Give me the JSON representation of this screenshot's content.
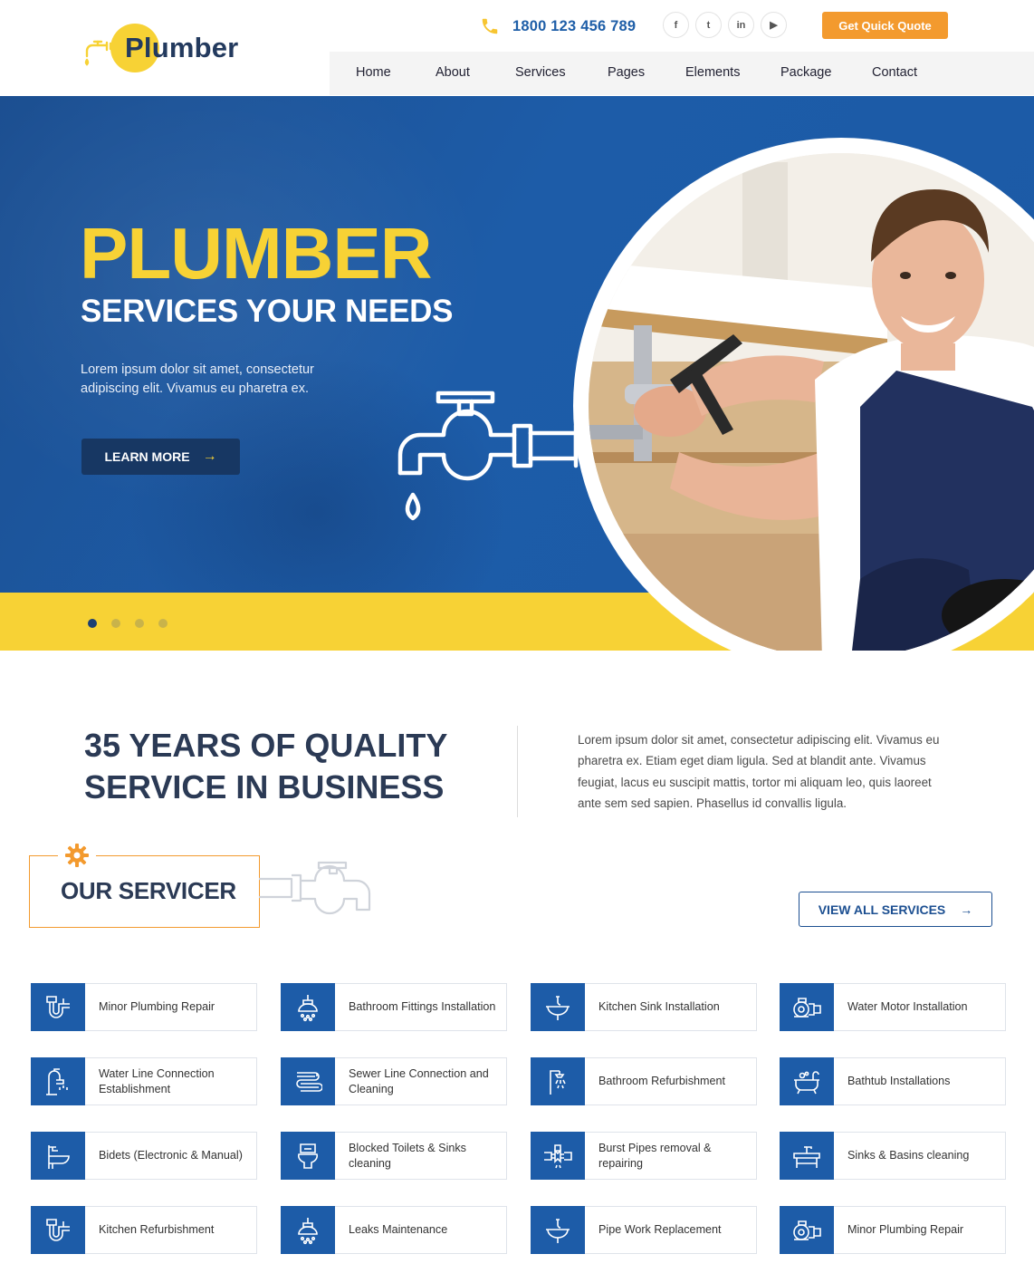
{
  "brand": {
    "name": "Plumber"
  },
  "topbar": {
    "phone": "1800 123 456 789",
    "socials": [
      {
        "icon": "facebook-icon",
        "glyph": "f"
      },
      {
        "icon": "twitter-icon",
        "glyph": "t"
      },
      {
        "icon": "linkedin-icon",
        "glyph": "in"
      },
      {
        "icon": "youtube-icon",
        "glyph": "▶"
      }
    ],
    "quote_label": "Get Quick Quote"
  },
  "nav": {
    "items": [
      "Home",
      "About",
      "Services",
      "Pages",
      "Elements",
      "Package",
      "Contact"
    ]
  },
  "hero": {
    "title": "PLUMBER",
    "subtitle": "SERVICES YOUR NEEDS",
    "description": "Lorem ipsum dolor sit amet, consectetur adipiscing elit. Vivamus eu pharetra ex.",
    "button": "LEARN MORE",
    "slides": 4,
    "active_slide": 1
  },
  "about": {
    "title": "35 YEARS OF QUALITY SERVICE IN BUSINESS",
    "description": "Lorem ipsum dolor sit amet, consectetur adipiscing elit. Vivamus eu pharetra ex. Etiam eget diam ligula. Sed at blandit ante. Vivamus feugiat, lacus eu suscipit mattis, tortor mi aliquam leo, quis laoreet ante sem sed sapien. Phasellus id convallis ligula."
  },
  "services": {
    "heading": "OUR SERVICER",
    "view_all": "VIEW ALL SERVICES",
    "items": [
      {
        "label": "Minor Plumbing Repair",
        "icon": "pipe-trap-icon"
      },
      {
        "label": "Bathroom Fittings Installation",
        "icon": "shower-head-icon"
      },
      {
        "label": "Kitchen Sink Installation",
        "icon": "sink-icon"
      },
      {
        "label": "Water Motor Installation",
        "icon": "water-motor-icon"
      },
      {
        "label": "Water Line Connection Establishment",
        "icon": "faucet-icon"
      },
      {
        "label": "Sewer Line Connection and Cleaning",
        "icon": "sewer-pipe-icon"
      },
      {
        "label": "Bathroom Refurbishment",
        "icon": "shower-icon"
      },
      {
        "label": "Bathtub Installations",
        "icon": "bathtub-icon"
      },
      {
        "label": "Bidets (Electronic & Manual)",
        "icon": "bidet-icon"
      },
      {
        "label": "Blocked Toilets & Sinks cleaning",
        "icon": "toilet-icon"
      },
      {
        "label": "Burst Pipes removal & repairing",
        "icon": "burst-pipe-icon"
      },
      {
        "label": "Sinks & Basins cleaning",
        "icon": "basin-icon"
      },
      {
        "label": "Kitchen Refurbishment",
        "icon": "pipe-trap-icon"
      },
      {
        "label": "Leaks Maintenance",
        "icon": "shower-head-icon"
      },
      {
        "label": "Pipe Work Replacement",
        "icon": "sink-icon"
      },
      {
        "label": "Minor Plumbing Repair",
        "icon": "water-motor-icon"
      }
    ]
  },
  "colors": {
    "primary_blue": "#1d5ca8",
    "dark_navy": "#233a5e",
    "accent_yellow": "#f7d235",
    "accent_orange": "#f39a2e"
  }
}
